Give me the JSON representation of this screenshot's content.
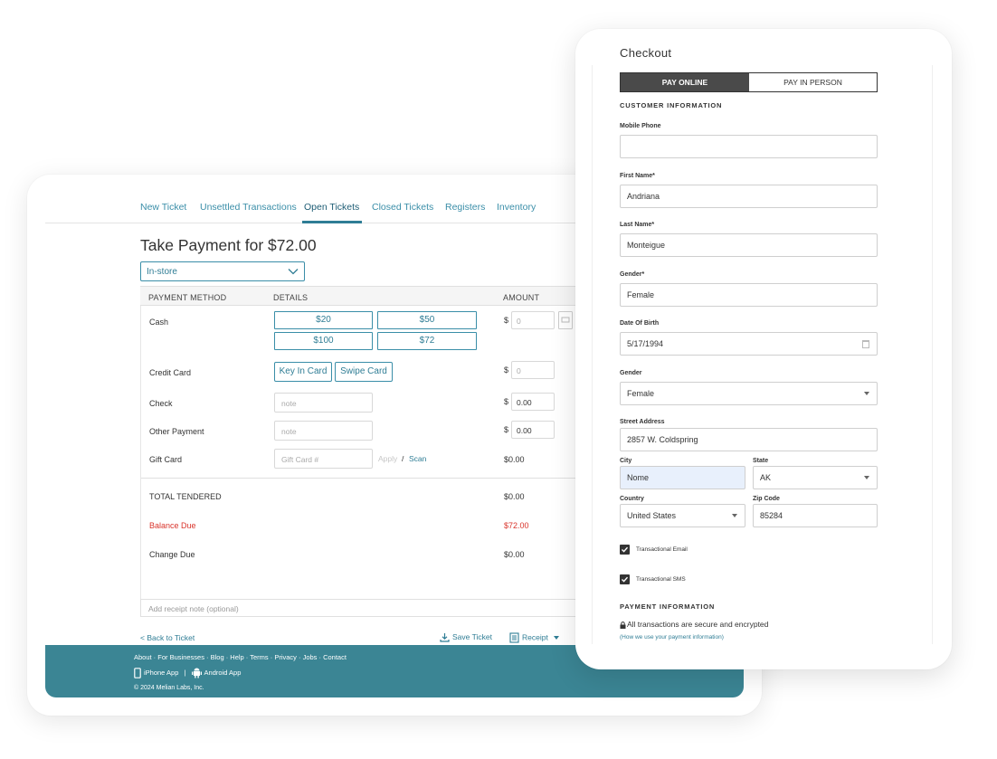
{
  "pos": {
    "nav": [
      "New Ticket",
      "Unsettled Transactions",
      "Open Tickets",
      "Closed Tickets",
      "Registers",
      "Inventory"
    ],
    "active_tab": "Open Tickets",
    "title": "Take Payment for $72.00",
    "location_select": "In-store",
    "table_headers": {
      "method": "PAYMENT METHOD",
      "details": "DETAILS",
      "amount": "AMOUNT"
    },
    "cash": {
      "label": "Cash",
      "quick_amounts": [
        "$20",
        "$50",
        "$100",
        "$72"
      ],
      "amount_placeholder": "0"
    },
    "credit_card": {
      "label": "Credit Card",
      "key_in": "Key In Card",
      "swipe": "Swipe Card",
      "amount_placeholder": "0"
    },
    "check": {
      "label": "Check",
      "note_placeholder": "note",
      "amount": "0.00"
    },
    "other": {
      "label": "Other Payment",
      "note_placeholder": "note",
      "amount": "0.00"
    },
    "gift_card": {
      "label": "Gift Card",
      "placeholder": "Gift Card #",
      "apply": "Apply",
      "separator": "/",
      "scan": "Scan",
      "amount": "$0.00"
    },
    "dollar_sign": "$",
    "totals": {
      "tendered_label": "TOTAL TENDERED",
      "tendered_value": "$0.00",
      "balance_label": "Balance Due",
      "balance_value": "$72.00",
      "change_label": "Change Due",
      "change_value": "$0.00"
    },
    "receipt_note_placeholder": "Add receipt note (optional)",
    "back_link": "< Back to Ticket",
    "save_ticket": "Save Ticket",
    "receipt": "Receipt",
    "footer": {
      "links": "About · For Businesses · Blog · Help · Terms · Privacy · Jobs · Contact",
      "iphone": "iPhone App",
      "app_separator": "|",
      "android": "Android App",
      "copyright": "© 2024 Melian Labs, Inc."
    }
  },
  "checkout": {
    "title": "Checkout",
    "tabs": {
      "online": "PAY ONLINE",
      "in_person": "PAY IN PERSON"
    },
    "customer_section": "CUSTOMER INFORMATION",
    "fields": {
      "mobile_label": "Mobile Phone",
      "mobile_value": "",
      "first_label": "First Name*",
      "first_value": "Andriana",
      "last_label": "Last Name*",
      "last_value": "Monteigue",
      "gender_req_label": "Gender*",
      "gender_req_value": "Female",
      "dob_label": "Date Of Birth",
      "dob_value": "5/17/1994",
      "gender_label": "Gender",
      "gender_value": "Female",
      "street_label": "Street Address",
      "street_value": "2857 W. Coldspring",
      "city_label": "City",
      "city_value": "Nome",
      "state_label": "State",
      "state_value": "AK",
      "country_label": "Country",
      "country_value": "United States",
      "zip_label": "Zip Code",
      "zip_value": "85284"
    },
    "email_opt": "Transactional Email",
    "sms_opt": "Transactional SMS",
    "payment_section": "PAYMENT INFORMATION",
    "secure_text": "All transactions are secure and encrypted",
    "how_link": "(How we use your payment information)"
  },
  "colors": {
    "accent": "#2f7d95",
    "footer": "#3b8594",
    "danger": "#d9342b"
  }
}
